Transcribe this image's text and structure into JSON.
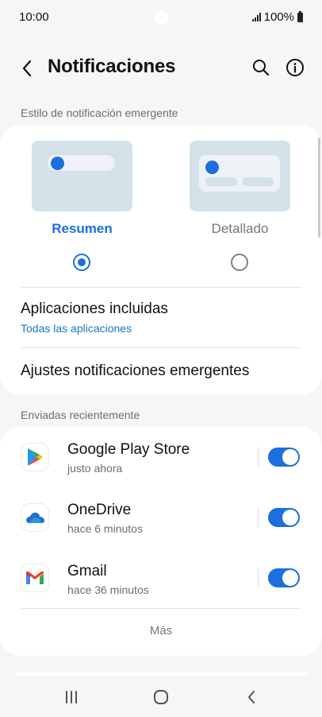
{
  "status_bar": {
    "time": "10:00",
    "battery": "100%"
  },
  "header": {
    "title": "Notificaciones",
    "back_icon": "chevron-left-icon",
    "search_icon": "search-icon",
    "info_icon": "info-icon"
  },
  "popup_style": {
    "section_label": "Estilo de notificación emergente",
    "options": [
      {
        "label": "Resumen",
        "selected": true
      },
      {
        "label": "Detallado",
        "selected": false
      }
    ],
    "included_apps": {
      "title": "Aplicaciones incluidas",
      "value": "Todas las aplicaciones"
    },
    "popup_settings": {
      "title": "Ajustes notificaciones emergentes"
    }
  },
  "recent": {
    "section_label": "Enviadas recientemente",
    "apps": [
      {
        "name": "Google Play Store",
        "time": "justo ahora",
        "enabled": true,
        "icon": "play-store-icon"
      },
      {
        "name": "OneDrive",
        "time": "hace 6 minutos",
        "enabled": true,
        "icon": "onedrive-icon"
      },
      {
        "name": "Gmail",
        "time": "hace 36 minutos",
        "enabled": true,
        "icon": "gmail-icon"
      }
    ],
    "more_label": "Más"
  },
  "colors": {
    "accent": "#1b6fde",
    "link": "#1677c8",
    "preview_bg": "#d4e1e8",
    "background": "#f6f6f6"
  }
}
